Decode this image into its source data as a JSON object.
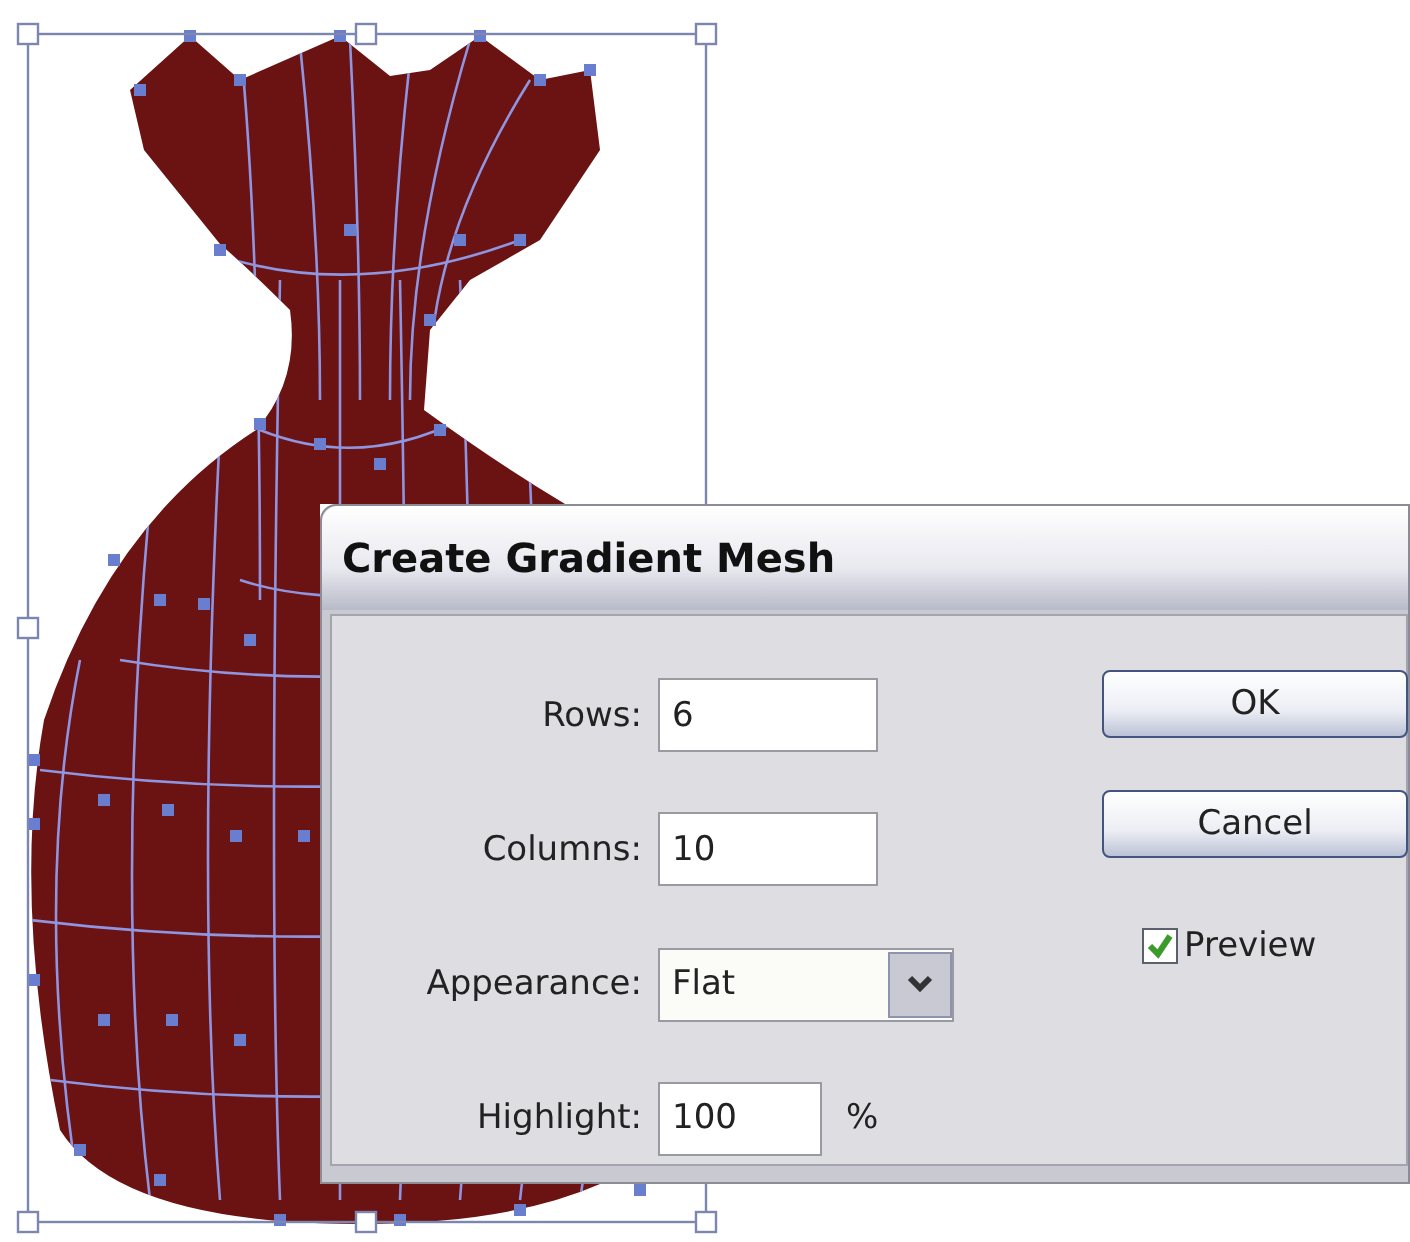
{
  "dialog": {
    "title": "Create Gradient Mesh",
    "fields": [
      {
        "kind": "text",
        "label": "Rows:",
        "value": "6"
      },
      {
        "kind": "text",
        "label": "Columns:",
        "value": "10"
      },
      {
        "kind": "dropdown",
        "label": "Appearance:",
        "value": "Flat"
      },
      {
        "kind": "text",
        "label": "Highlight:",
        "value": "100",
        "unit": "%"
      }
    ],
    "buttons": [
      "OK",
      "Cancel"
    ],
    "preview": {
      "label": "Preview",
      "checked": true
    }
  }
}
